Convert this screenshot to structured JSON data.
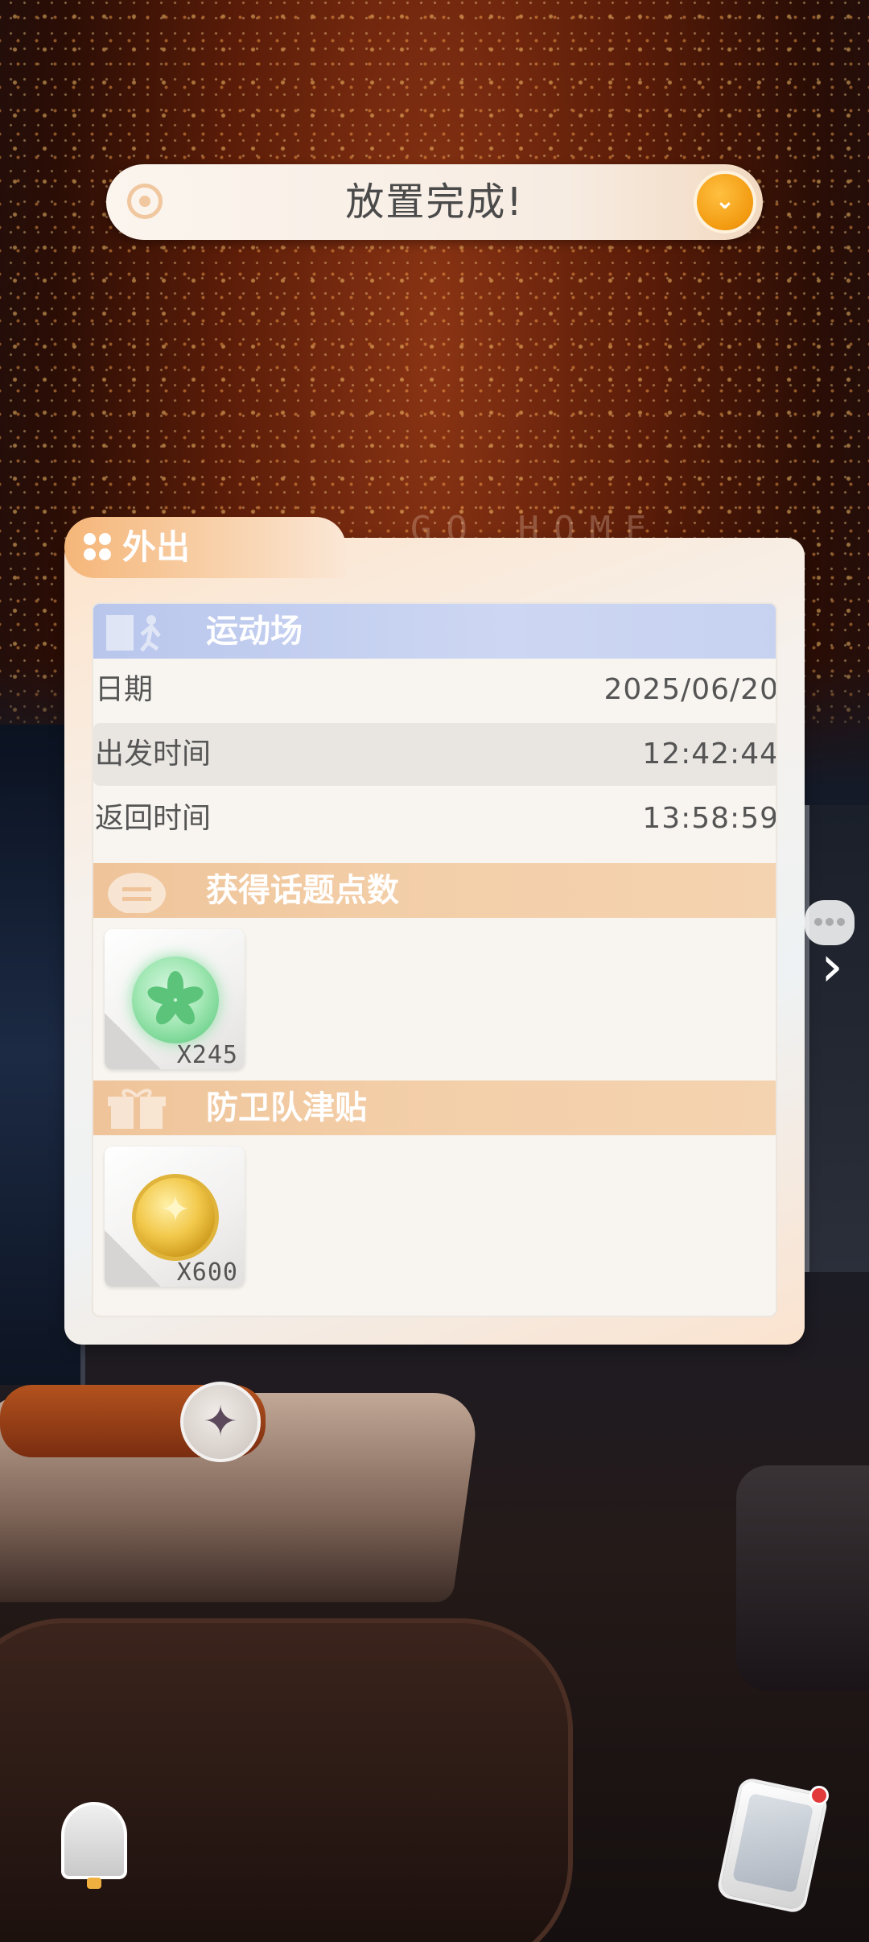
{
  "toast": {
    "message": "放置完成!"
  },
  "panel": {
    "tab_label": "外出",
    "location": {
      "title": "运动场",
      "date_label": "日期",
      "date_value": "2025/06/20",
      "depart_label": "出发时间",
      "depart_value": "12:42:44",
      "return_label": "返回时间",
      "return_value": "13:58:59"
    },
    "topic_points": {
      "title": "获得话题点数",
      "count": "X245"
    },
    "allowance": {
      "title": "防卫队津贴",
      "count": "X600"
    }
  },
  "background": {
    "deco_text": "GO HOME"
  },
  "icons": {
    "toast_left": "loop-icon",
    "toast_right": "double-chevron-down-icon",
    "tab": "four-dots-icon",
    "compass": "compass-star-icon",
    "bell": "bell-icon",
    "phone": "phone-icon",
    "side_arrow": "chevron-right-icon"
  },
  "colors": {
    "accent_orange": "#f29a10",
    "tab_orange": "#f5b679",
    "section_blue": "#b9c6ec",
    "section_orange": "#efc49a",
    "notification_red": "#e23a3a"
  }
}
